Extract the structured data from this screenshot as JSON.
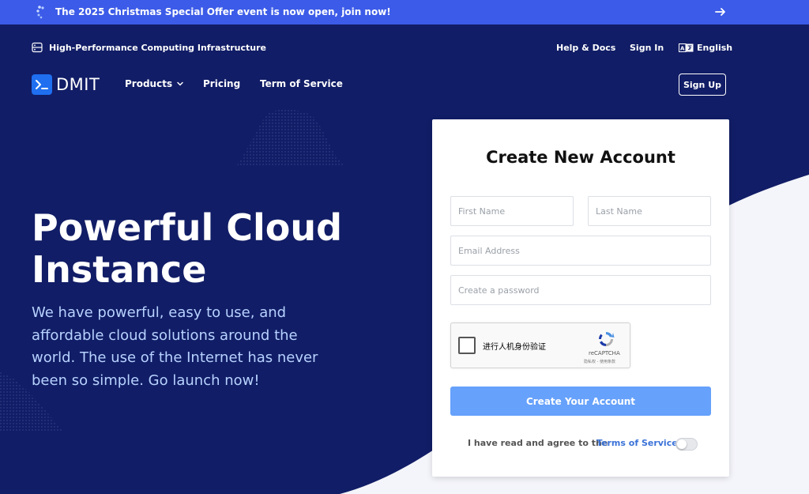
{
  "announcement": {
    "text": "The 2025 Christmas Special Offer event is now open, join now!",
    "icons": {
      "spinner": "spinner-icon",
      "arrow": "arrow-right-icon"
    }
  },
  "utility": {
    "tagline": "High-Performance Computing Infrastructure",
    "help": "Help & Docs",
    "signin": "Sign In",
    "language": "English"
  },
  "nav": {
    "brand": "DMIT",
    "products": "Products",
    "pricing": "Pricing",
    "terms": "Term of Service",
    "signup": "Sign Up"
  },
  "hero": {
    "title": "Powerful Cloud Instance",
    "subtitle": "We have powerful, easy to use, and affordable cloud solutions around the world. The use of the Internet has never been so simple. Go launch now!"
  },
  "form": {
    "title": "Create New Account",
    "first_name": {
      "value": "",
      "placeholder": "First Name"
    },
    "last_name": {
      "value": "",
      "placeholder": "Last Name"
    },
    "email": {
      "value": "",
      "placeholder": "Email Address"
    },
    "password": {
      "value": "",
      "placeholder": "Create a password"
    },
    "captcha": {
      "label": "进行人机身份验证",
      "brand": "reCAPTCHA",
      "links": "隐私权 - 使用条款"
    },
    "submit": "Create Your Account",
    "agree_text": "I have read and agree to the",
    "agree_link": "Terms of Service"
  },
  "colors": {
    "topbar": "#3c5be8",
    "hero_bg": "#111d66",
    "button": "#66a1fb",
    "link": "#3a72d8",
    "subtitle": "#b7d2ff"
  }
}
